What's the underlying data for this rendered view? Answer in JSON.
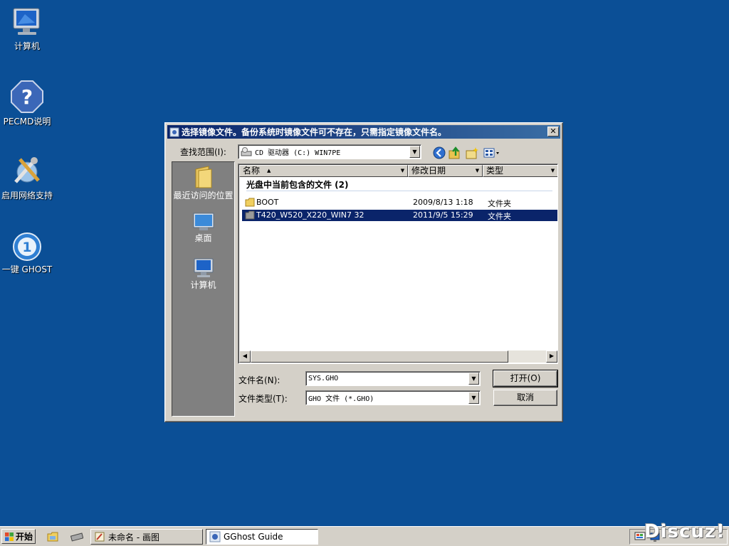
{
  "desktop": {
    "icons": [
      {
        "label": "计算机"
      },
      {
        "label": "PECMD说明"
      },
      {
        "label": "启用网络支持"
      },
      {
        "label": "一键 GHOST"
      }
    ]
  },
  "dialog": {
    "title": "选择镜像文件。备份系统时镜像文件可不存在，只需指定镜像文件名。",
    "close_glyph": "✕",
    "look_in_label": "查找范围(I):",
    "look_in_value": "CD 驱动器 (C:) WIN7PE",
    "places": [
      {
        "label": "最近访问的位置"
      },
      {
        "label": "桌面"
      },
      {
        "label": "计算机"
      }
    ],
    "columns": [
      {
        "label": "名称"
      },
      {
        "label": "修改日期"
      },
      {
        "label": "类型"
      }
    ],
    "group_title": "光盘中当前包含的文件 (2)",
    "files": [
      {
        "name": "BOOT",
        "date": "2009/8/13 1:18",
        "type": "文件夹",
        "selected": false
      },
      {
        "name": "T420_W520_X220_WIN7 32",
        "date": "2011/9/5 15:29",
        "type": "文件夹",
        "selected": true
      }
    ],
    "filename_label": "文件名(N):",
    "filename_value": "SYS.GHO",
    "filetype_label": "文件类型(T):",
    "filetype_value": "GHO 文件 (*.GHO)",
    "open_button": "打开(O)",
    "cancel_button": "取消"
  },
  "taskbar": {
    "start_label": "开始",
    "tasks": [
      {
        "label": "未命名 - 画图",
        "active": false
      },
      {
        "label": "GGhost Guide",
        "active": true
      }
    ]
  },
  "watermark": "Discuz!",
  "colors": {
    "desktop": "#0b4f96",
    "titlebar": "#0a246a",
    "selection": "#0a246a",
    "face": "#d4d0c8"
  }
}
